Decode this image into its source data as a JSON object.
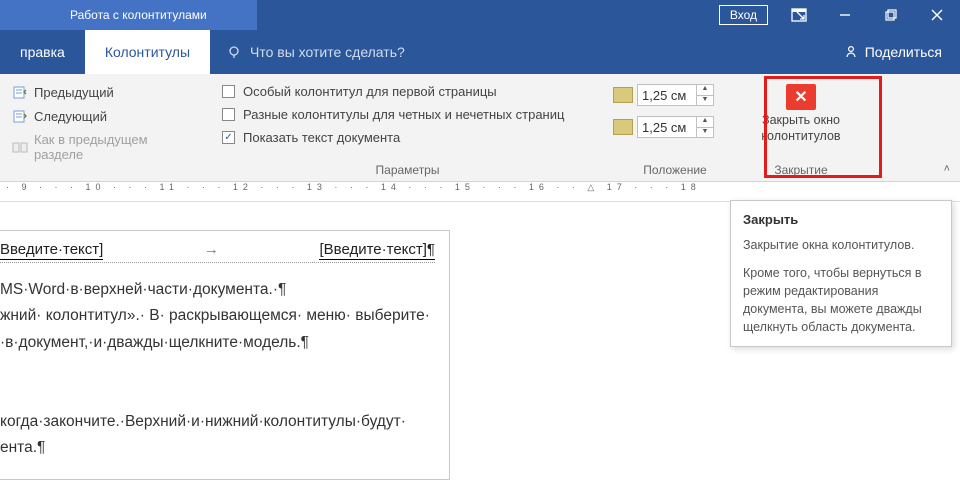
{
  "titlebar": {
    "context_title": "Работа с колонтитулами",
    "login": "Вход"
  },
  "tabs": {
    "left_tab": "правка",
    "active_tab": "Колонтитулы",
    "tell_me": "Что вы хотите сделать?",
    "share": "Поделиться"
  },
  "ribbon": {
    "nav": {
      "prev": "Предыдущий",
      "next": "Следующий",
      "as_prev": "Как в предыдущем разделе"
    },
    "options": {
      "first_page": "Особый колонтитул для первой страницы",
      "odd_even": "Разные колонтитулы для четных и нечетных страниц",
      "show_text": "Показать текст документа",
      "group_label": "Параметры"
    },
    "position": {
      "top": "1,25 см",
      "bottom": "1,25 см",
      "group_label": "Положение"
    },
    "close": {
      "label": "Закрыть окно колонтитулов",
      "group_label": "Закрытие"
    }
  },
  "document": {
    "header_left": "Введите·текст]",
    "header_right": "[Введите·текст]¶",
    "body_lines": [
      "MS·Word·в·верхней·части·документа.·¶",
      "жний· колонтитул».· В· раскрывающемся· меню· выберите·",
      "·в·документ,·и·дважды·щелкните·модель.¶",
      "",
      "",
      "когда·закончите.·Верхний·и·нижний·колонтитулы·будут·",
      "ента.¶"
    ]
  },
  "tooltip": {
    "title": "Закрыть",
    "p1": "Закрытие окна колонтитулов.",
    "p2": "Кроме того, чтобы вернуться в режим редактирования документа, вы можете дважды щелкнуть область документа."
  },
  "ruler_text": "· 9 · · · 10 · · · 11 · · · 12 · · · 13 · · · 14 · · · 15 · · · 16 · · △ 17 · · · 18"
}
